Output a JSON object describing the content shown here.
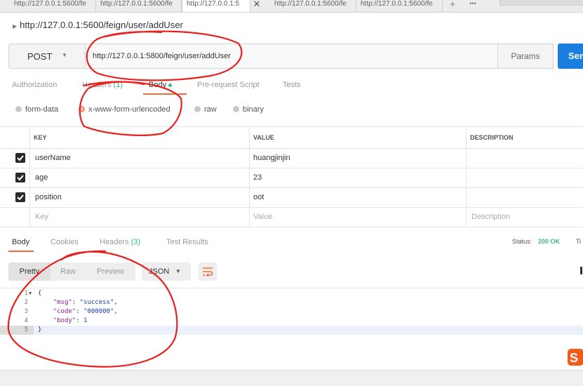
{
  "tabs": [
    {
      "label": "http://127.0.0.1:5600/fe"
    },
    {
      "label": "http://127.0.0.1:5600/fe"
    },
    {
      "label": "http://127.0.0.1:5"
    },
    {
      "label": "http://127.0.0.1:5600/fe"
    },
    {
      "label": "http://127.0.0.1:5600/fe"
    }
  ],
  "tab_close": "✕",
  "tab_add": "+",
  "tab_more": "•••",
  "request": {
    "title": "http://127.0.0.1:5600/feign/user/addUser",
    "method": "POST",
    "url": "http://127.0.0.1:5800/feign/user/addUser",
    "params_label": "Params",
    "send_label": "Send"
  },
  "request_tabs": {
    "authorization": "Authorization",
    "headers": "Headers",
    "headers_count": "(1)",
    "body": "Body",
    "prerequest": "Pre-request Script",
    "tests": "Tests"
  },
  "body_modes": [
    "form-data",
    "x-www-form-urlencoded",
    "raw",
    "binary"
  ],
  "body_mode_selected": "x-www-form-urlencoded",
  "kv": {
    "headers": {
      "key": "KEY",
      "value": "VALUE",
      "description": "DESCRIPTION"
    },
    "rows": [
      {
        "key": "userName",
        "value": "huangjinjin",
        "checked": true
      },
      {
        "key": "age",
        "value": "23",
        "checked": true
      },
      {
        "key": "position",
        "value": "oot",
        "checked": true
      }
    ],
    "placeholders": {
      "key": "Key",
      "value": "Value",
      "description": "Description"
    }
  },
  "response_tabs": {
    "body": "Body",
    "cookies": "Cookies",
    "headers": "Headers",
    "headers_count": "(3)",
    "test_results": "Test Results"
  },
  "status": {
    "label": "Status:",
    "value": "200 OK",
    "time_label": "Ti"
  },
  "view_modes": {
    "pretty": "Pretty",
    "raw": "Raw",
    "preview": "Preview"
  },
  "format": "JSON",
  "code": {
    "line_numbers": [
      "1",
      "2",
      "3",
      "4",
      "5"
    ],
    "lines": [
      {
        "text": "{"
      },
      {
        "key": "\"msg\"",
        "value": "\"success\""
      },
      {
        "key": "\"code\"",
        "value": "\"000000\""
      },
      {
        "key": "\"body\"",
        "value": "1"
      },
      {
        "text": "}"
      }
    ]
  },
  "colors": {
    "accent": "#f26b3a",
    "send": "#1a7de0",
    "status_ok": "#43b883",
    "annotation": "#e8201e"
  },
  "icons": [
    "close-icon",
    "plus-icon",
    "more-icon",
    "caret-right-icon",
    "chevron-down-icon",
    "check-icon",
    "wrap-lines-icon",
    "sogou-ime-icon"
  ]
}
